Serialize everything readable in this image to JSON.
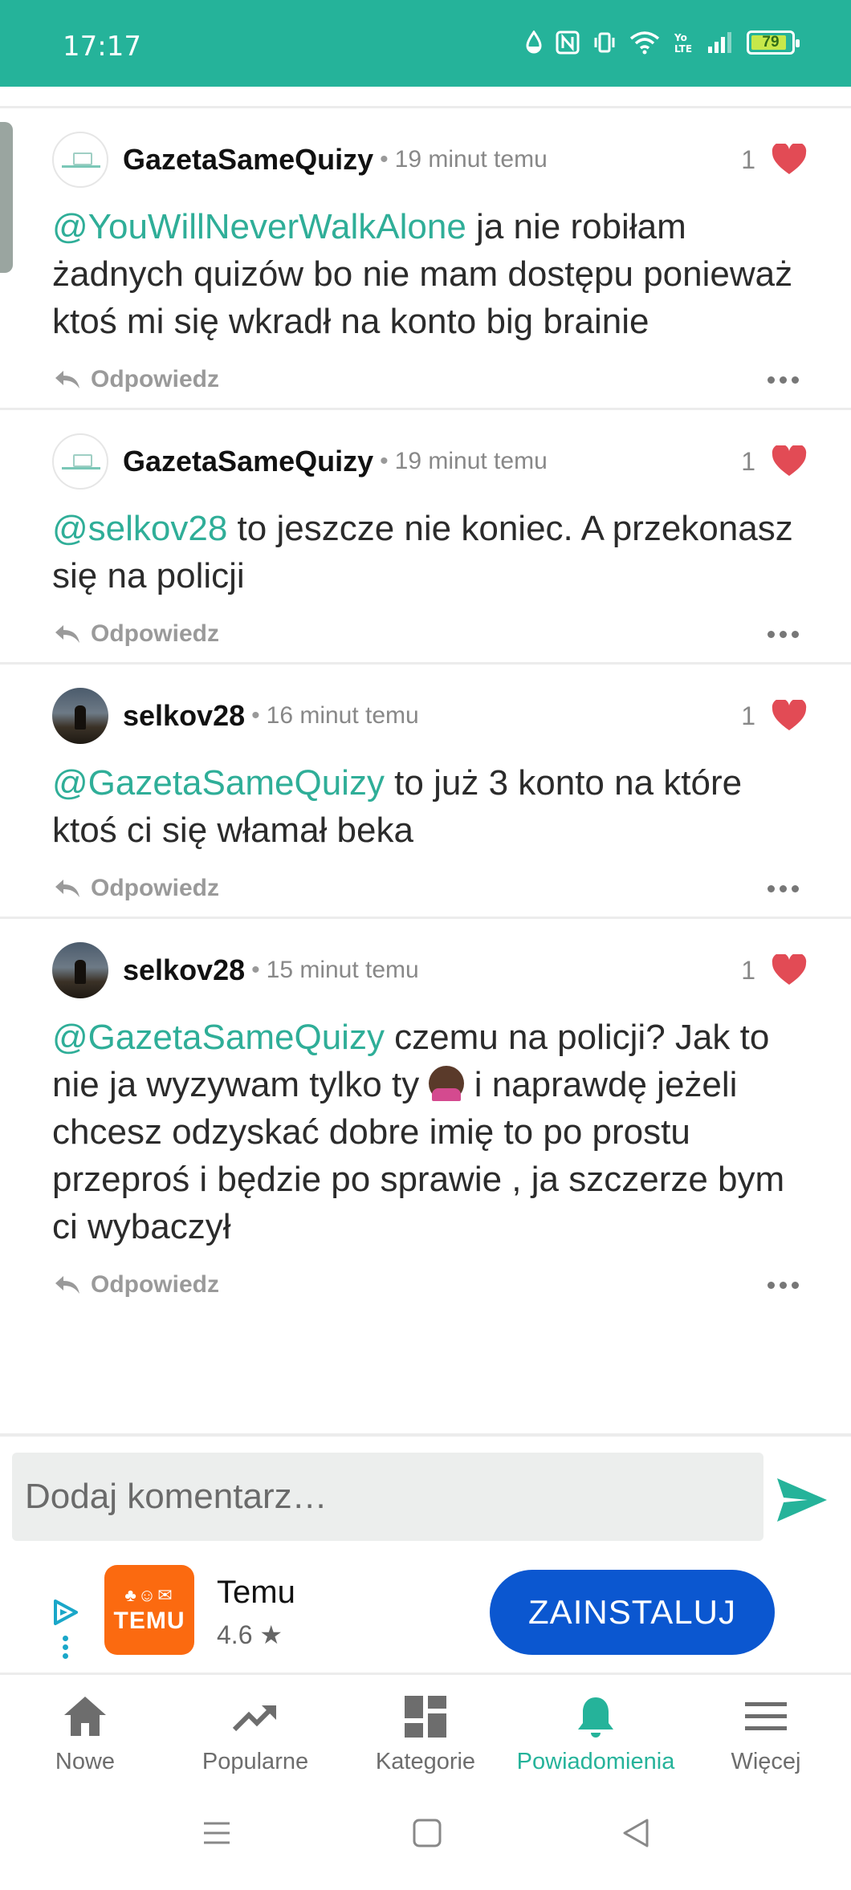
{
  "status_bar": {
    "time": "17:17",
    "battery": "79"
  },
  "comments": [
    {
      "author": "GazetaSameQuizy",
      "time": "19 minut temu",
      "likes": "1",
      "mention": "@YouWillNeverWalkAlone",
      "text": " ja nie robiłam żadnych quizów bo nie mam dostępu ponieważ ktoś mi się wkradł na konto big brainie",
      "reply_label": "Odpowiedz"
    },
    {
      "author": "GazetaSameQuizy",
      "time": "19 minut temu",
      "likes": "1",
      "mention": "@selkov28",
      "text": " to jeszcze nie koniec. A przekonasz się na policji",
      "reply_label": "Odpowiedz"
    },
    {
      "author": "selkov28",
      "time": "16 minut temu",
      "likes": "1",
      "mention": "@GazetaSameQuizy",
      "text": " to już 3 konto na które ktoś ci się włamał beka",
      "reply_label": "Odpowiedz"
    },
    {
      "author": "selkov28",
      "time": "15 minut temu",
      "likes": "1",
      "mention": "@GazetaSameQuizy",
      "text": " czemu na policji? Jak to nie ja wyzywam tylko ty",
      "text_after_emoji": " i naprawdę jeżeli chcesz odzyskać dobre imię to po prostu przeproś i będzie po sprawie , ja szczerze bym ci wybaczył",
      "reply_label": "Odpowiedz"
    }
  ],
  "comment_input": {
    "placeholder": "Dodaj komentarz…"
  },
  "ad": {
    "app_name": "Temu",
    "rating": "4.6 ★",
    "logo_text": "TEMU",
    "install_label": "ZAINSTALUJ"
  },
  "bottom_nav": {
    "items": [
      {
        "label": "Nowe"
      },
      {
        "label": "Popularne"
      },
      {
        "label": "Kategorie"
      },
      {
        "label": "Powiadomienia"
      },
      {
        "label": "Więcej"
      }
    ],
    "active": "Powiadomienia"
  },
  "colors": {
    "accent": "#25b39a",
    "heart": "#e24b55",
    "install": "#0b57d0",
    "temu": "#fb6a10"
  }
}
